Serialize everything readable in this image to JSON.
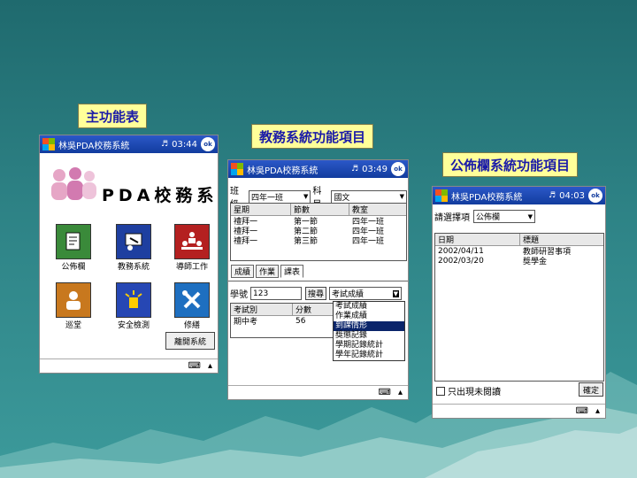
{
  "captions": {
    "main": "主功能表",
    "academic": "教務系統功能項目",
    "bulletin": "公佈欄系統功能項目"
  },
  "phone1": {
    "title": "林吳PDA校務系統",
    "time": "03:44",
    "ok": "ok",
    "logo_text": "PDA校務系統",
    "apps": [
      "公佈欄",
      "教務系統",
      "導師工作",
      "巡堂",
      "安全檢測",
      "修繕"
    ],
    "exit_button": "離開系統",
    "bottom_icons": [
      "keyboard-icon",
      "scroll-up-icon"
    ]
  },
  "phone2": {
    "title": "林吳PDA校務系統",
    "time": "03:49",
    "ok": "ok",
    "class_label": "班級",
    "class_value": "四年一班",
    "subject_label": "科目",
    "subject_value": "國文",
    "table_headers": [
      "星期",
      "節數",
      "教室"
    ],
    "table_rows": [
      [
        "禮拜一",
        "第一節",
        "四年一班"
      ],
      [
        "禮拜一",
        "第二節",
        "四年一班"
      ],
      [
        "禮拜一",
        "第三節",
        "四年一班"
      ]
    ],
    "tabs": [
      "成績",
      "作業",
      "課表"
    ],
    "student_no_label": "學號",
    "student_no_value": "123",
    "query_button": "搜尋",
    "query_select": "考試成績",
    "score_headers": [
      "考試別",
      "分數"
    ],
    "score_rows": [
      [
        "期中考",
        "56"
      ]
    ],
    "dropdown_options": [
      "考試成績",
      "作業成績",
      "到課情形",
      "獎懲記錄",
      "學期記錄統計",
      "學年記錄統計"
    ],
    "dropdown_selected": "到課情形"
  },
  "phone3": {
    "title": "林吳PDA校務系統",
    "time": "04:03",
    "ok": "ok",
    "select_label": "請選擇項",
    "select_value": "公佈欄",
    "table_headers": [
      "日期",
      "標題"
    ],
    "table_rows": [
      [
        "2002/04/11",
        "教師研習事項"
      ],
      [
        "2002/03/20",
        "獎學金"
      ]
    ],
    "checkbox_label": "只出現未閱讀",
    "confirm_button": "確定"
  },
  "colors": {
    "background_top": "#1f6a6e",
    "background_bottom": "#3c9a9b",
    "caption_bg": "#ffff99",
    "caption_text": "#1a1aa8",
    "titlebar": "#2b58c8"
  }
}
